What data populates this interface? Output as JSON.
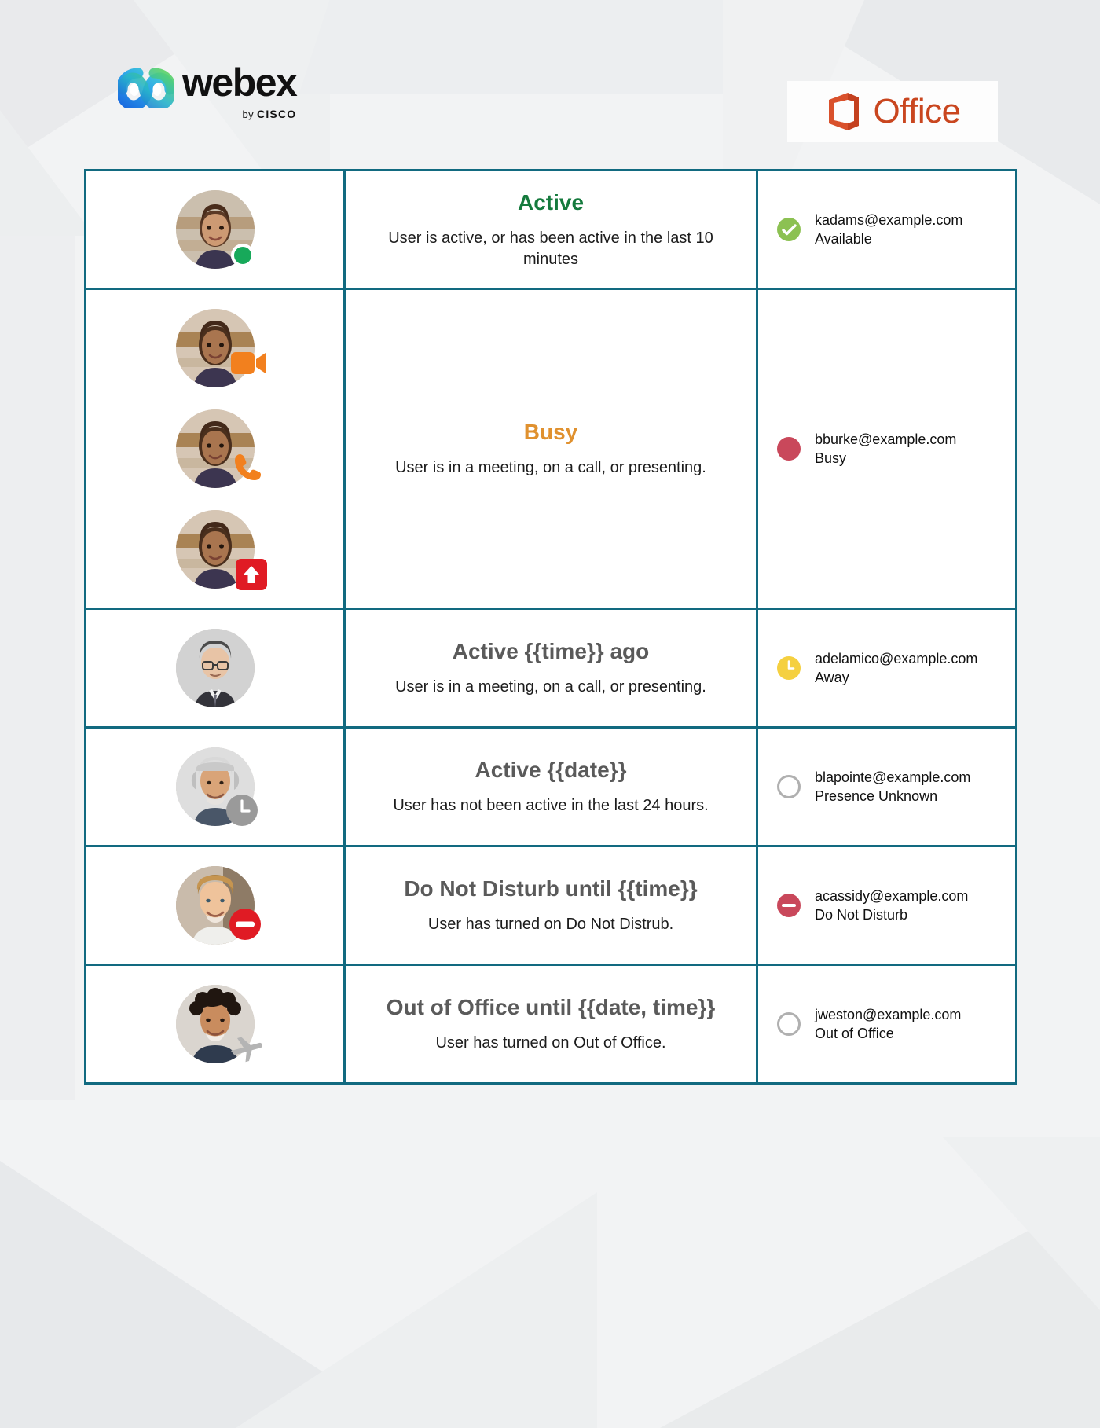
{
  "header": {
    "webex_word": "webex",
    "webex_by_prefix": "by ",
    "webex_by_brand": "CISCO",
    "office_label": "Office",
    "webex_logo_icon": "webex-logo-icon",
    "office_logo_icon": "office-logo-icon"
  },
  "colors": {
    "table_border": "#126a80",
    "active_green": "#157a3d",
    "busy_orange": "#e0912f",
    "neutral_gray": "#5a5a5a",
    "available_dot": "#8cc152",
    "busy_dot": "#c9485b",
    "away_dot": "#f5d040",
    "unknown_dot": "#b0b0b0",
    "dnd_dot": "#c9485b",
    "webex_blue": "#1a6ae0",
    "office_orange": "#c9461f"
  },
  "rows": [
    {
      "id": "active",
      "title": "Active",
      "title_color": "#157a3d",
      "body": "User is active, or has been active in the last 10 minutes",
      "avatars": [
        {
          "name": "avatar-active-woman",
          "badge": "presence-dot-green",
          "badge_label": "active-dot"
        }
      ],
      "presence": {
        "icon": "available-check-icon",
        "icon_color": "#8cc152",
        "email": "kadams@example.com",
        "status": "Available"
      }
    },
    {
      "id": "busy",
      "title": "Busy",
      "title_color": "#e0912f",
      "body": "User is in a meeting, on a call, or presenting.",
      "avatars": [
        {
          "name": "avatar-busy-meeting",
          "badge": "video-camera-icon",
          "badge_label": "in-a-meeting"
        },
        {
          "name": "avatar-busy-call",
          "badge": "phone-handset-icon",
          "badge_label": "on-a-call"
        },
        {
          "name": "avatar-busy-presenting",
          "badge": "screen-share-icon",
          "badge_label": "presenting"
        }
      ],
      "presence": {
        "icon": "busy-dot-icon",
        "icon_color": "#c9485b",
        "email": "bburke@example.com",
        "status": "Busy"
      }
    },
    {
      "id": "active-time-ago",
      "title": "Active {{time}} ago",
      "title_color": "#5a5a5a",
      "body": "User is in a meeting, on a call, or presenting.",
      "avatars": [
        {
          "name": "avatar-away-man",
          "badge": "none",
          "badge_label": "none"
        }
      ],
      "presence": {
        "icon": "away-clock-icon",
        "icon_color": "#f5d040",
        "email": "adelamico@example.com",
        "status": "Away"
      }
    },
    {
      "id": "active-date",
      "title": "Active {{date}}",
      "title_color": "#5a5a5a",
      "body": "User has not been active in the last 24 hours.",
      "avatars": [
        {
          "name": "avatar-inactive-man",
          "badge": "clock-gray-icon",
          "badge_label": "inactive-clock"
        }
      ],
      "presence": {
        "icon": "presence-unknown-icon",
        "icon_color": "#b0b0b0",
        "email": "blapointe@example.com",
        "status": "Presence Unknown"
      }
    },
    {
      "id": "do-not-disturb",
      "title": "Do Not Disturb until {{time}}",
      "title_color": "#5a5a5a",
      "body": "User has turned on Do Not Distrub.",
      "avatars": [
        {
          "name": "avatar-dnd-man",
          "badge": "do-not-disturb-icon",
          "badge_label": "do-not-disturb"
        }
      ],
      "presence": {
        "icon": "do-not-disturb-dot-icon",
        "icon_color": "#c9485b",
        "email": "acassidy@example.com",
        "status": "Do Not Disturb"
      }
    },
    {
      "id": "out-of-office",
      "title": "Out of Office until {{date, time}}",
      "title_color": "#5a5a5a",
      "body": "User has turned on Out of Office.",
      "avatars": [
        {
          "name": "avatar-ooo-man",
          "badge": "airplane-icon",
          "badge_label": "out-of-office"
        }
      ],
      "presence": {
        "icon": "out-of-office-icon",
        "icon_color": "#b0b0b0",
        "email": "jweston@example.com",
        "status": "Out of Office"
      }
    }
  ]
}
